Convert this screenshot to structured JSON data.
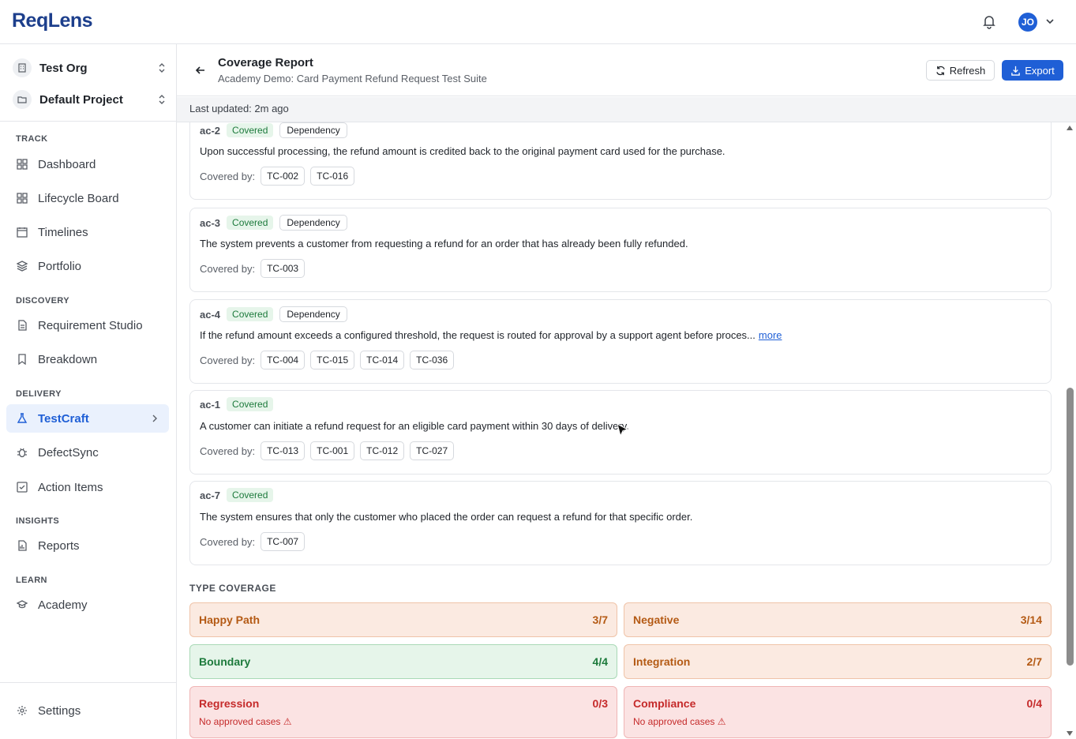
{
  "app": {
    "logo": "ReqLens",
    "user_initials": "JO"
  },
  "sidebar": {
    "org": "Test Org",
    "project": "Default Project",
    "sections": {
      "track": "TRACK",
      "discovery": "DISCOVERY",
      "delivery": "DELIVERY",
      "insights": "INSIGHTS",
      "learn": "LEARN"
    },
    "items": {
      "dashboard": "Dashboard",
      "lifecycle": "Lifecycle Board",
      "timelines": "Timelines",
      "portfolio": "Portfolio",
      "requirement_studio": "Requirement Studio",
      "breakdown": "Breakdown",
      "testcraft": "TestCraft",
      "defectsync": "DefectSync",
      "action_items": "Action Items",
      "reports": "Reports",
      "academy": "Academy",
      "settings": "Settings"
    },
    "active": "TestCraft"
  },
  "header": {
    "title": "Coverage Report",
    "subtitle": "Academy Demo: Card Payment Refund Request Test Suite",
    "refresh_label": "Refresh",
    "export_label": "Export"
  },
  "last_updated": "Last updated: 2m ago",
  "covered_by_label": "Covered by:",
  "criteria": [
    {
      "id": "ac-2",
      "status": "Covered",
      "tag": "Dependency",
      "text": "Upon successful processing, the refund amount is credited back to the original payment card used for the purchase.",
      "more": "",
      "tests": [
        "TC-002",
        "TC-016"
      ]
    },
    {
      "id": "ac-3",
      "status": "Covered",
      "tag": "Dependency",
      "text": "The system prevents a customer from requesting a refund for an order that has already been fully refunded.",
      "more": "",
      "tests": [
        "TC-003"
      ]
    },
    {
      "id": "ac-4",
      "status": "Covered",
      "tag": "Dependency",
      "text": "If the refund amount exceeds a configured threshold, the request is routed for approval by a support agent before proces...",
      "more": "more",
      "tests": [
        "TC-004",
        "TC-015",
        "TC-014",
        "TC-036"
      ]
    },
    {
      "id": "ac-1",
      "status": "Covered",
      "tag": "",
      "text": "A customer can initiate a refund request for an eligible card payment within 30 days of delivery.",
      "more": "",
      "tests": [
        "TC-013",
        "TC-001",
        "TC-012",
        "TC-027"
      ]
    },
    {
      "id": "ac-7",
      "status": "Covered",
      "tag": "",
      "text": "The system ensures that only the customer who placed the order can request a refund for that specific order.",
      "more": "",
      "tests": [
        "TC-007"
      ]
    }
  ],
  "type_coverage": {
    "title": "TYPE COVERAGE",
    "items": [
      {
        "name": "Happy Path",
        "value": "3/7",
        "warning": "",
        "status": "partial"
      },
      {
        "name": "Negative",
        "value": "3/14",
        "warning": "",
        "status": "partial"
      },
      {
        "name": "Boundary",
        "value": "4/4",
        "warning": "",
        "status": "full"
      },
      {
        "name": "Integration",
        "value": "2/7",
        "warning": "",
        "status": "partial"
      },
      {
        "name": "Regression",
        "value": "0/3",
        "warning": "No approved cases ⚠",
        "status": "none"
      },
      {
        "name": "Compliance",
        "value": "0/4",
        "warning": "No approved cases ⚠",
        "status": "none"
      }
    ]
  },
  "colors": {
    "accent": "#1f5fd6",
    "covered": "#1d7a3c",
    "partial": "#b45a14",
    "none": "#c52a2a"
  }
}
